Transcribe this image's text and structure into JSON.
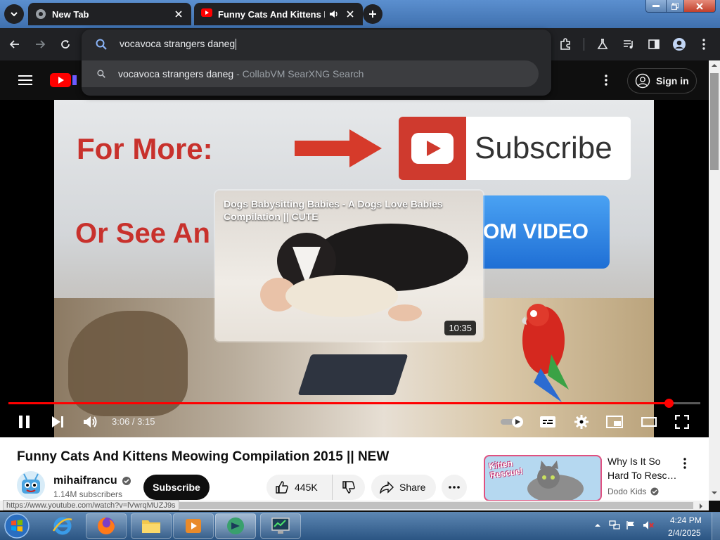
{
  "browser": {
    "tabs": [
      {
        "title": "New Tab"
      },
      {
        "title": "Funny Cats And Kittens Me"
      }
    ],
    "omnibox": {
      "input_value": "vocavoca strangers daneg",
      "suggestion_query": "vocavoca strangers daneg",
      "suggestion_source": " - CollabVM SearXNG Search"
    },
    "status_url": "https://www.youtube.com/watch?v=lVwrqMUZJ9s"
  },
  "youtube": {
    "signin_label": "Sign in",
    "player": {
      "video_art": {
        "for_more": "For More:",
        "subscribe": "Subscribe",
        "or_see": "Or See An",
        "random_video": "DOM VIDEO"
      },
      "endcard": {
        "title": "Dogs Babysitting Babies - A Dogs Love Babies Compilation || CUTE",
        "duration": "10:35"
      },
      "timecode": "3:06 / 3:15",
      "progress": 0.955
    },
    "video_title": "Funny Cats And Kittens Meowing Compilation 2015 || NEW",
    "channel": {
      "name": "mihaifrancu",
      "subscribers": "1.14M subscribers",
      "subscribe_label": "Subscribe"
    },
    "actions": {
      "likes": "445K",
      "share_label": "Share"
    },
    "recommended": {
      "title": "Why Is It So Hard To Resc…",
      "channel": "Dodo Kids",
      "thumb_text": "Kitten Rescue!"
    }
  },
  "taskbar": {
    "time": "4:24 PM",
    "date": "2/4/2025"
  },
  "colors": {
    "youtube_red": "#ff0000",
    "chrome_dark": "#202124",
    "win7_taskbar": "#2b5583"
  }
}
